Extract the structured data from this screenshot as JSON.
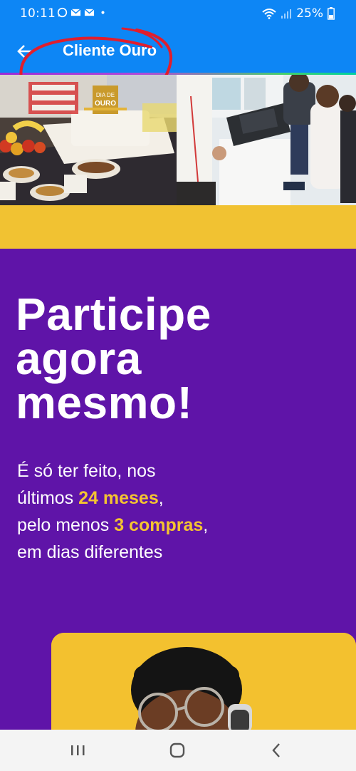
{
  "status_bar": {
    "time": "10:11",
    "battery": "25%"
  },
  "app_bar": {
    "title": "Cliente Ouro"
  },
  "hero": {
    "sign_text_line1": "DIA DE",
    "sign_text_line2": "OURO"
  },
  "headline": {
    "line1": "Participe",
    "line2": "agora",
    "line3": "mesmo!"
  },
  "body": {
    "line1": "É só ter feito, nos",
    "line2_prefix": "últimos ",
    "line2_highlight": "24 meses",
    "line2_suffix": ",",
    "line3_prefix": "pelo menos ",
    "line3_highlight": "3 compras",
    "line3_suffix": ",",
    "line4": "em dias diferentes"
  },
  "colors": {
    "app_bar": "#0d86f5",
    "purple": "#5f14a8",
    "yellow": "#f1c232",
    "highlight": "#f4c431"
  }
}
